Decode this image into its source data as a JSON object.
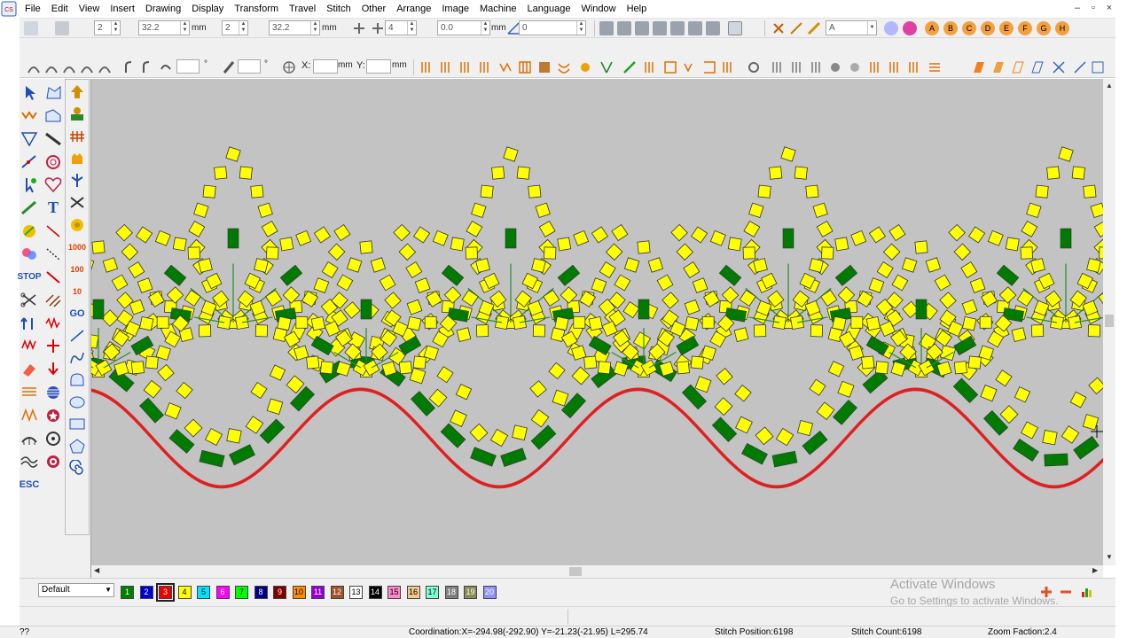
{
  "menu": [
    "File",
    "Edit",
    "View",
    "Insert",
    "Drawing",
    "Display",
    "Transform",
    "Travel",
    "Stitch",
    "Other",
    "Arrange",
    "Image",
    "Machine",
    "Language",
    "Window",
    "Help"
  ],
  "window_controls": [
    "–",
    "▫",
    "×"
  ],
  "toolbar1": {
    "field1": "2",
    "field2": "32.2",
    "unit2": "mm",
    "field3": "2",
    "field4": "32.2",
    "unit4": "mm",
    "field5": "4",
    "field6": "0.0",
    "unit6": "mm",
    "field7": "0",
    "font_select": "A",
    "letter_buttons": [
      "A",
      "B",
      "C",
      "D",
      "E",
      "F",
      "G",
      "H"
    ]
  },
  "toolbar2": {
    "x_label": "X:",
    "x_value": "",
    "x_unit": "mm",
    "y_label": "Y:",
    "y_value": "",
    "y_unit": "mm"
  },
  "tools": {
    "stop_label": "STOP",
    "go_label": "GO",
    "esc_label": "ESC",
    "text_tool_label": "T",
    "counter_1000": "1000",
    "counter_100": "100",
    "counter_10": "10"
  },
  "thread_select": "Default",
  "threads": [
    {
      "n": "1",
      "color": "#008000",
      "text": "#fff"
    },
    {
      "n": "2",
      "color": "#0000cc",
      "text": "#fff"
    },
    {
      "n": "3",
      "color": "#ee0000",
      "text": "#fff"
    },
    {
      "n": "4",
      "color": "#ffff00",
      "text": "#000"
    },
    {
      "n": "5",
      "color": "#00e5ff",
      "text": "#000"
    },
    {
      "n": "6",
      "color": "#ff00ff",
      "text": "#fff"
    },
    {
      "n": "7",
      "color": "#00ff00",
      "text": "#000"
    },
    {
      "n": "8",
      "color": "#000080",
      "text": "#fff"
    },
    {
      "n": "9",
      "color": "#800000",
      "text": "#fff"
    },
    {
      "n": "10",
      "color": "#ff8c00",
      "text": "#000"
    },
    {
      "n": "11",
      "color": "#9400d3",
      "text": "#fff"
    },
    {
      "n": "12",
      "color": "#a0522d",
      "text": "#fff"
    },
    {
      "n": "13",
      "color": "#ffffff",
      "text": "#000"
    },
    {
      "n": "14",
      "color": "#000000",
      "text": "#fff"
    },
    {
      "n": "15",
      "color": "#ff88cc",
      "text": "#000"
    },
    {
      "n": "16",
      "color": "#f4c88a",
      "text": "#000"
    },
    {
      "n": "17",
      "color": "#7fffd4",
      "text": "#000"
    },
    {
      "n": "18",
      "color": "#808080",
      "text": "#fff"
    },
    {
      "n": "19",
      "color": "#8b8b56",
      "text": "#fff"
    },
    {
      "n": "20",
      "color": "#9090ff",
      "text": "#fff"
    }
  ],
  "activate_windows": {
    "title": "Activate Windows",
    "subtitle": "Go to Settings to activate Windows."
  },
  "status": {
    "left": "??",
    "coordination": "Coordination:X=-294.98(-292.90) Y=-21.23(-21.95) L=295.74",
    "stitch_position": "Stitch Position:6198",
    "stitch_count": "Stitch Count:6198",
    "zoom": "Zoom Faction:2.4"
  },
  "colors": {
    "yellow": "#ffff00",
    "green": "#007a00",
    "red": "#e02020",
    "canvas": "#c3c3c3"
  }
}
